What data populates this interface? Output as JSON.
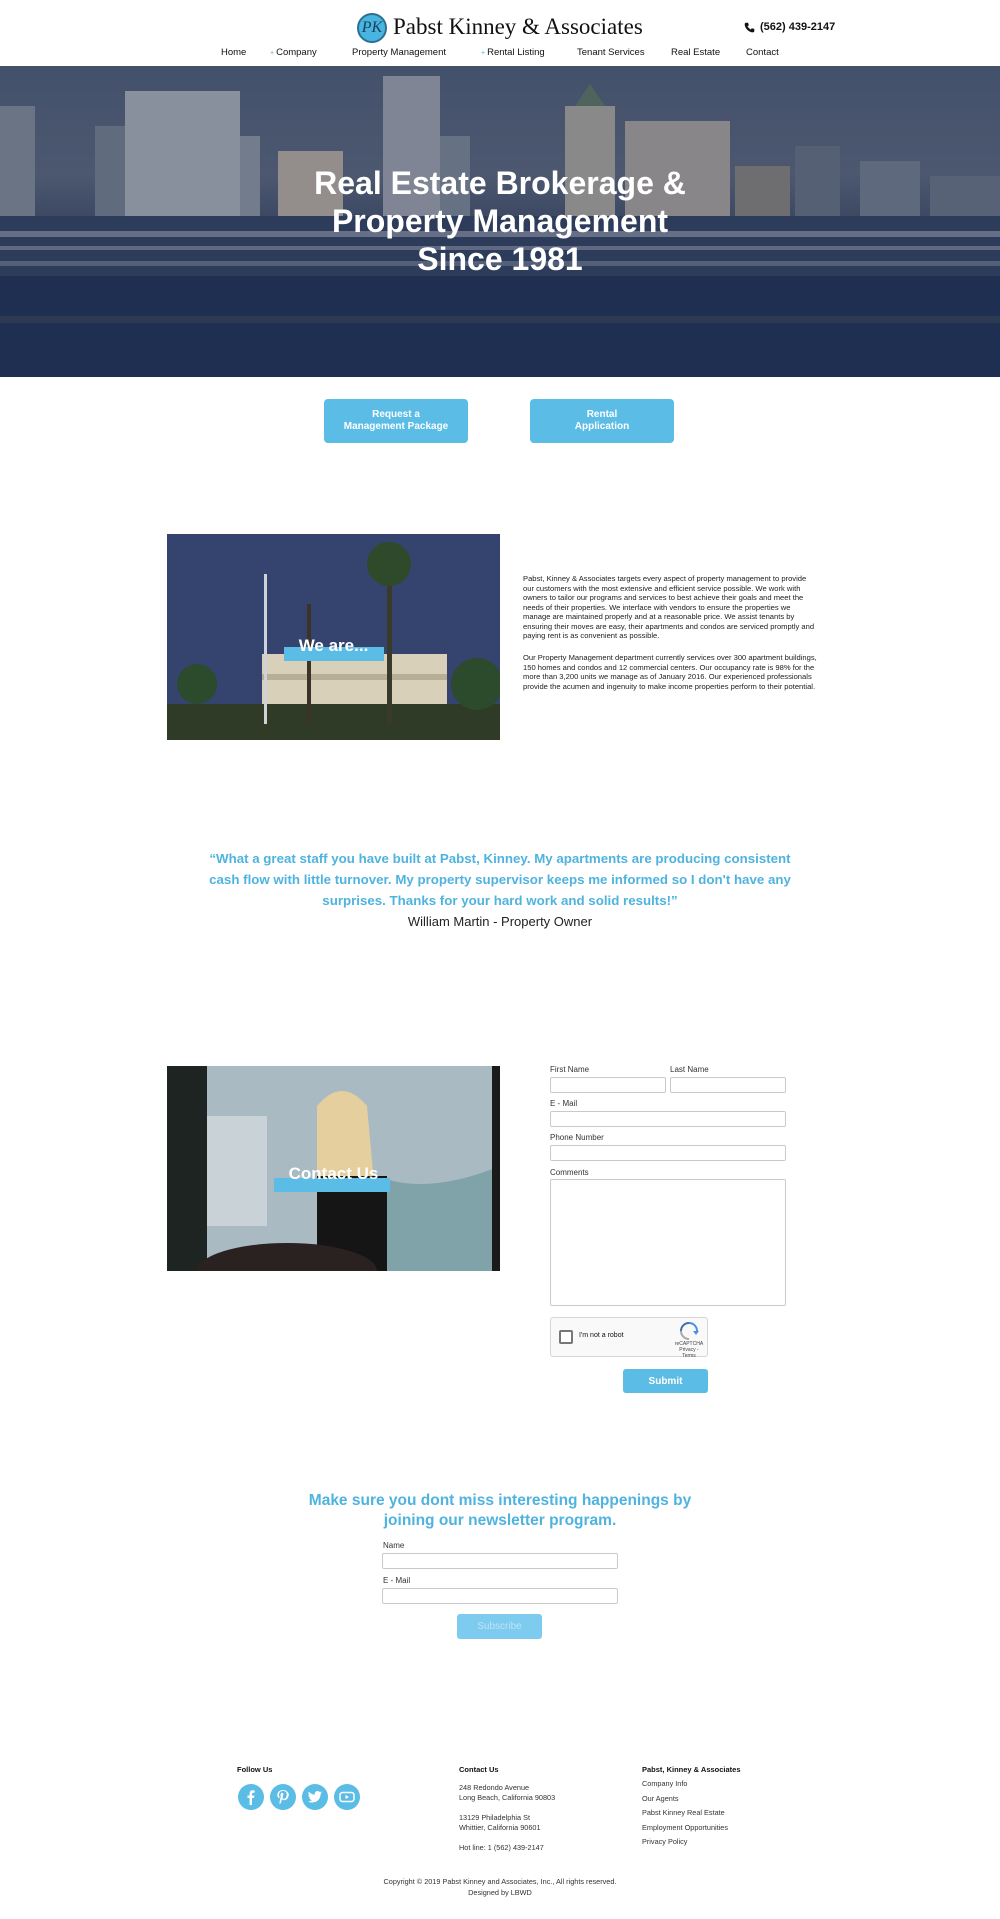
{
  "header": {
    "brand": "Pabst Kinney & Associates",
    "logo_letters": "PK",
    "phone": "(562) 439-2147",
    "nav": [
      {
        "label": "Home",
        "has_dropdown": false
      },
      {
        "label": "Company",
        "has_dropdown": true
      },
      {
        "label": "Property Management",
        "has_dropdown": false
      },
      {
        "label": "Rental Listing",
        "has_dropdown": true
      },
      {
        "label": "Tenant Services",
        "has_dropdown": false
      },
      {
        "label": "Real Estate",
        "has_dropdown": false
      },
      {
        "label": "Contact",
        "has_dropdown": false
      }
    ],
    "dropdown_caret": "+"
  },
  "hero": {
    "title": "Real Estate Brokerage &\nProperty Management\nSince 1981"
  },
  "cta": {
    "management_package": "Request a\nManagement Package",
    "rental_application": "Rental\nApplication"
  },
  "about": {
    "image_label": "We are...",
    "paragraph1": "Pabst, Kinney & Associates targets every aspect of property management to provide our customers with the most extensive and efficient service possible. We work with owners to tailor our programs and services to best achieve their goals and meet the needs of their properties. We interface with vendors to ensure the properties we manage are maintained properly and at a reasonable price. We assist tenants by ensuring their moves are easy, their apartments and condos are serviced promptly and paying rent is as convenient as possible.",
    "paragraph2": "Our Property Management department currently services over 300 apartment buildings, 150 homes and condos and 12 commercial centers. Our occupancy rate is 98% for the more than 3,200 units we manage as of January 2016. Our experienced professionals provide the acumen and ingenuity to make income properties perform to their potential."
  },
  "testimonial": {
    "quote": "“What a great staff you have built at Pabst, Kinney. My apartments are producing consistent cash flow with little turnover. My property supervisor keeps me informed so I don't have any surprises. Thanks for your hard work and solid results!”",
    "author": "William Martin - Property Owner"
  },
  "contact": {
    "image_label": "Contact Us",
    "first_name_label": "First Name",
    "last_name_label": "Last Name",
    "email_label": "E - Mail",
    "phone_label": "Phone Number",
    "comments_label": "Comments",
    "first_name_value": "",
    "last_name_value": "",
    "email_value": "",
    "phone_value": "",
    "comments_value": "",
    "captcha_text": "I'm not a robot",
    "captcha_brand": "reCAPTCHA",
    "captcha_links": "Privacy - Terms",
    "submit_label": "Submit"
  },
  "newsletter": {
    "title": "Make sure you dont miss interesting happenings by\njoining our newsletter program.",
    "name_label": "Name",
    "email_label": "E - Mail",
    "name_value": "",
    "email_value": "",
    "subscribe_label": "Subscribe"
  },
  "footer": {
    "follow_heading": "Follow Us",
    "social_icons": [
      "facebook-icon",
      "pinterest-icon",
      "twitter-icon",
      "youtube-icon"
    ],
    "contact_heading": "Contact Us",
    "address1": "248 Redondo Avenue\nLong Beach, California 90803",
    "address2": "13129 Philadelphia St\nWhittier, California 90601",
    "hotline": "Hot line: 1 (562) 439-2147",
    "company_heading": "Pabst, Kinney & Associates",
    "links": [
      "Company Info",
      "Our Agents",
      "Pabst Kinney Real Estate",
      "Employment Opportunities",
      "Privacy Policy"
    ],
    "copyright": "Copyright © 2019 Pabst Kinney and Associates, Inc., All rights reserved.",
    "designed_by": "Designed by LBWD"
  },
  "colors": {
    "accent": "#5bbce6",
    "accent_text": "#4fb3df",
    "subscribe_button": "#7dcbef",
    "subscribe_text": "#bfe4f6"
  }
}
